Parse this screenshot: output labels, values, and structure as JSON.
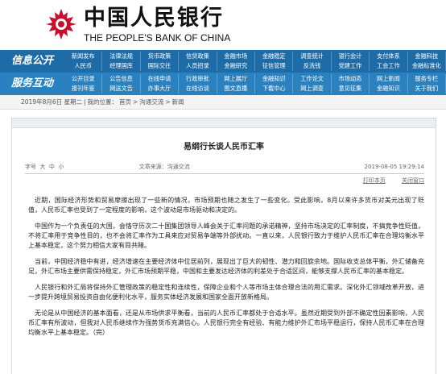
{
  "header": {
    "logo_cn": "中国人民银行",
    "logo_en": "THE PEOPLE'S BANK OF CHINA",
    "logo_color": "#c8102e"
  },
  "nav": {
    "info": {
      "title": "信息公开",
      "items": [
        "新闻发布",
        "法律法规",
        "货币政策",
        "信贷政策",
        "金融市场",
        "金融稳定",
        "调查统计",
        "银行会计",
        "支付体系",
        "金融科技",
        "人民币",
        "经理国库",
        "国际交往",
        "人员招录",
        "金融研究",
        "征信管理",
        "反洗钱",
        "党建工作",
        "工会工作",
        "金融标准化"
      ]
    },
    "service": {
      "title": "服务互动",
      "items": [
        "公开目录",
        "公告信息",
        "在线申请",
        "行政审批",
        "网上展厅",
        "金融知识",
        "工作论文",
        "市场动态",
        "网上新闻",
        "服务专栏",
        "报刊年鉴",
        "网送文告",
        "办事大厅",
        "在线访谈",
        "图文直播",
        "下载中心",
        "网上调查",
        "意见征集",
        "金融知识",
        "关于我们"
      ]
    }
  },
  "breadcrumb": [
    "2019年8月6日 星期二",
    "|",
    "我的位置：",
    "首页",
    ">",
    "沟通交流",
    ">",
    "新闻"
  ],
  "article": {
    "title": "易纲行长谈人民币汇率",
    "meta_left": "字号  大  中  小                                          文章来源：沟通交流",
    "date": "2019-08-05  19:29:14",
    "actions": [
      "打印本页",
      "关闭窗口"
    ],
    "paragraphs": [
      "近期，国际经济形势和贸易摩擦出现了一些新的情况，市场预期也随之发生了一些变化。受此影响，8月以来许多货币对美元出现了贬值，人民币汇率也受到了一定程度的影响，这个波动是市场驱动和决定的。",
      "中国作为一个负责任的大国，会恪守历次二十国集团领导人峰会关于汇率问题的承诺精神，坚持市场决定的汇率制度，不搞竞争性贬值，不将汇率用于竞争性目的，也不会将汇率作为工具来应对贸易争端等外部扰动。一直以来，人民银行致力于维护人民币汇率在合理均衡水平上基本稳定，这个努力相信大家有目共睹。",
      "当前，中国经济稳中有进，经济增速在主要经济体中位居前列，展现出了巨大的韧性、潜力和回旋余地。国际收支总体平衡，外汇储备充足，外汇市场主要供需保持稳定，外汇市场预期平稳，中国和主要发达经济体的利差处于合适区间，能够支撑人民币汇率的基本稳定。",
      "人民银行和外汇局将保持外汇管理政策的稳定性和连续性，保障企业和个人等市场主体合理合法的用汇需求。深化外汇领域改革开放，进一步提升跨境贸易投资自由化便利化水平，服务实体经济发展和国家全面开放新格局。",
      "无论是从中国经济的基本面看，还是从市场供求平衡看，当前的人民币汇率都处于合适水平。虽然近期受到外部不确定性因素影响，人民币汇率有所波动，但我对人民币继续作为强势货币充满信心。人民银行完全有经验、有能力维护外汇市场平稳运行，保持人民币汇率在合理均衡水平上基本稳定。（完）"
    ]
  }
}
